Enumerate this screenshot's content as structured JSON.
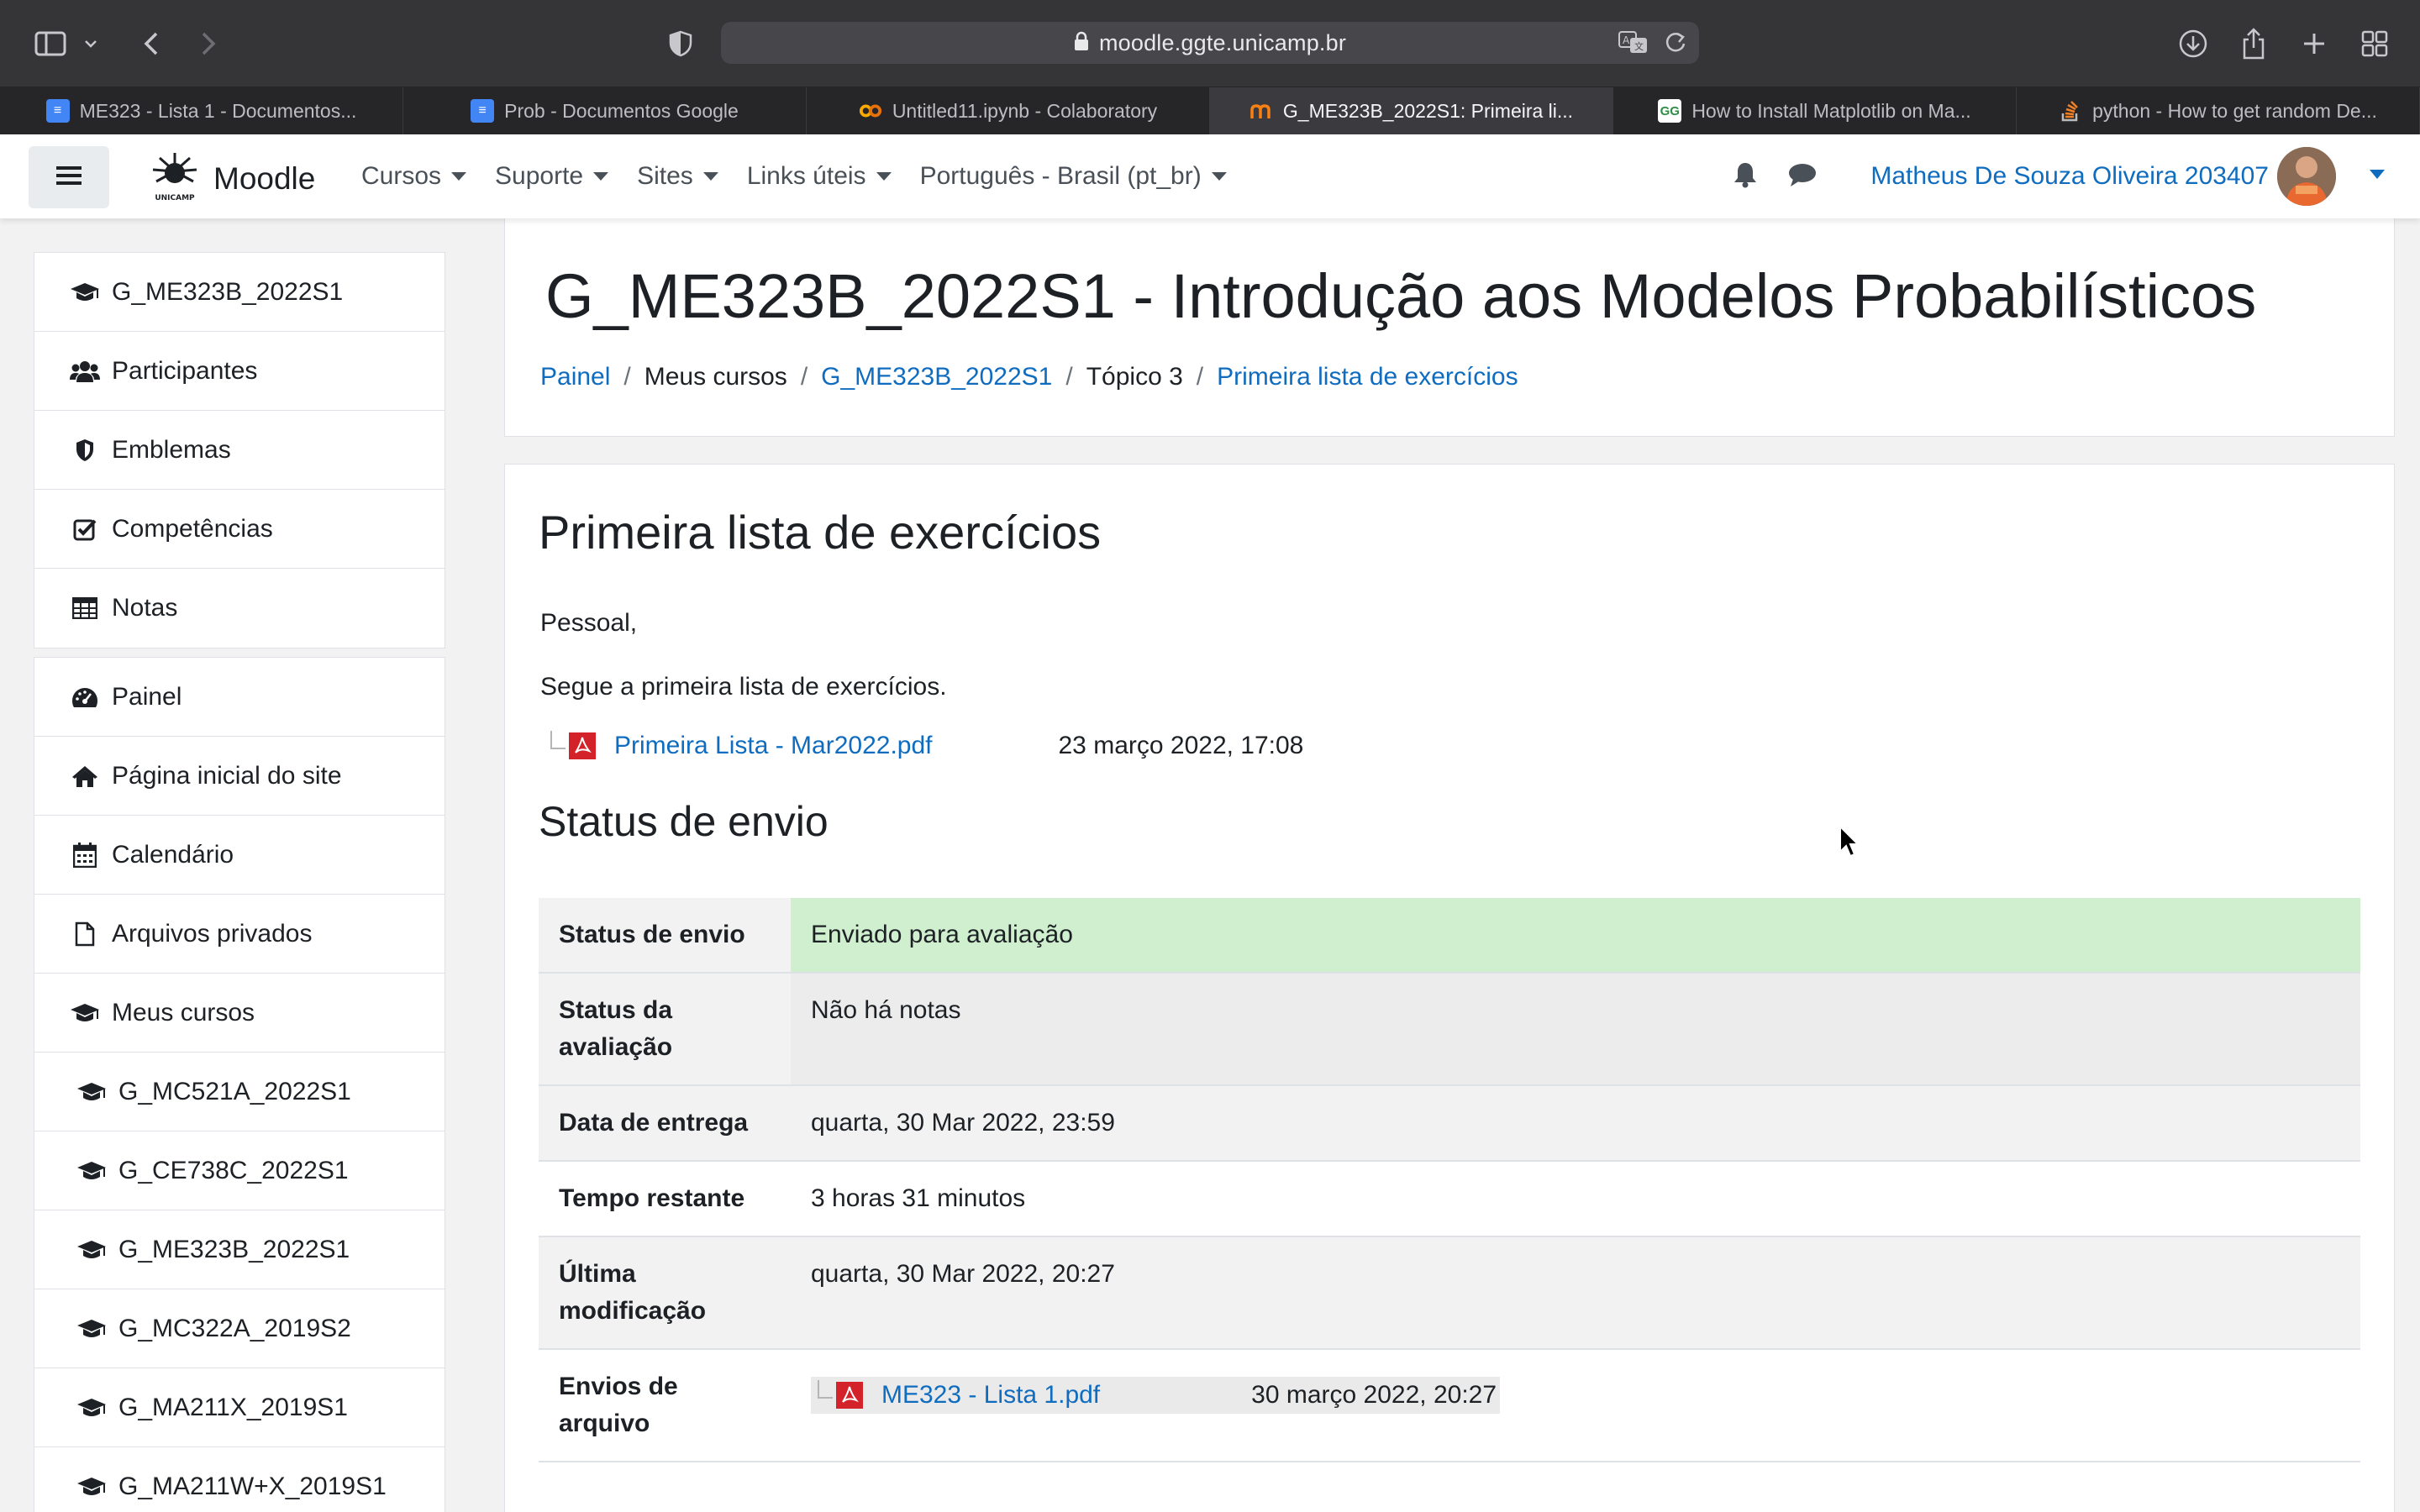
{
  "browser": {
    "url": "moodle.ggte.unicamp.br",
    "tabs": [
      {
        "label": "ME323 - Lista 1 - Documentos...",
        "icon": "google-docs-icon",
        "active": false
      },
      {
        "label": "Prob - Documentos Google",
        "icon": "google-docs-icon",
        "active": false
      },
      {
        "label": "Untitled11.ipynb - Colaboratory",
        "icon": "colab-icon",
        "active": false
      },
      {
        "label": "G_ME323B_2022S1: Primeira li...",
        "icon": "moodle-icon",
        "active": true
      },
      {
        "label": "How to Install Matplotlib on Ma...",
        "icon": "geeksforgeeks-icon",
        "active": false
      },
      {
        "label": "python - How to get random De...",
        "icon": "stackoverflow-icon",
        "active": false
      }
    ]
  },
  "navbar": {
    "brand": "Moodle",
    "brand_sub": "UNICAMP",
    "menu": [
      {
        "label": "Cursos"
      },
      {
        "label": "Suporte"
      },
      {
        "label": "Sites"
      },
      {
        "label": "Links úteis"
      },
      {
        "label": "Português - Brasil (pt_br)"
      }
    ],
    "user_name": "Matheus De Souza Oliveira 203407"
  },
  "drawer": {
    "course_items": [
      {
        "label": "G_ME323B_2022S1",
        "icon": "graduation-cap-icon"
      },
      {
        "label": "Participantes",
        "icon": "users-icon"
      },
      {
        "label": "Emblemas",
        "icon": "shield-icon"
      },
      {
        "label": "Competências",
        "icon": "check-square-icon"
      },
      {
        "label": "Notas",
        "icon": "table-icon"
      }
    ],
    "site_items": [
      {
        "label": "Painel",
        "icon": "dashboard-icon"
      },
      {
        "label": "Página inicial do site",
        "icon": "home-icon"
      },
      {
        "label": "Calendário",
        "icon": "calendar-icon"
      },
      {
        "label": "Arquivos privados",
        "icon": "file-icon"
      },
      {
        "label": "Meus cursos",
        "icon": "graduation-cap-icon"
      },
      {
        "label": "G_MC521A_2022S1",
        "icon": "graduation-cap-icon"
      },
      {
        "label": "G_CE738C_2022S1",
        "icon": "graduation-cap-icon"
      },
      {
        "label": "G_ME323B_2022S1",
        "icon": "graduation-cap-icon"
      },
      {
        "label": "G_MC322A_2019S2",
        "icon": "graduation-cap-icon"
      },
      {
        "label": "G_MA211X_2019S1",
        "icon": "graduation-cap-icon"
      },
      {
        "label": "G_MA211W+X_2019S1",
        "icon": "graduation-cap-icon"
      }
    ]
  },
  "header": {
    "course_title": "G_ME323B_2022S1 - Introdução aos Modelos Probabilísticos",
    "breadcrumb": [
      "Painel",
      "Meus cursos",
      "G_ME323B_2022S1",
      "Tópico 3",
      "Primeira lista de exercícios"
    ]
  },
  "activity": {
    "title": "Primeira lista de exercícios",
    "intro_line1": "Pessoal,",
    "intro_line2": "Segue a primeira lista de exercícios.",
    "file_name": "Primeira Lista - Mar2022.pdf",
    "file_date": "23 março 2022, 17:08",
    "status_heading": "Status de envio"
  },
  "status_table": [
    {
      "label": "Status de envio",
      "value": "Enviado para avaliação",
      "color": "#cfefcf"
    },
    {
      "label": "Status da avaliação",
      "value": "Não há notas"
    },
    {
      "label": "Data de entrega",
      "value": "quarta, 30 Mar 2022, 23:59"
    },
    {
      "label": "Tempo restante",
      "value": "3 horas 31 minutos"
    },
    {
      "label": "Última modificação",
      "value": "quarta, 30 Mar 2022, 20:27"
    },
    {
      "label": "Envios de arquivo",
      "file_name": "ME323 - Lista 1.pdf",
      "file_date": "30 março 2022, 20:27"
    }
  ],
  "colors": {
    "link": "#0f6cbf",
    "submitted_bg": "#cfefcf",
    "pdf_red": "#d3222a"
  }
}
